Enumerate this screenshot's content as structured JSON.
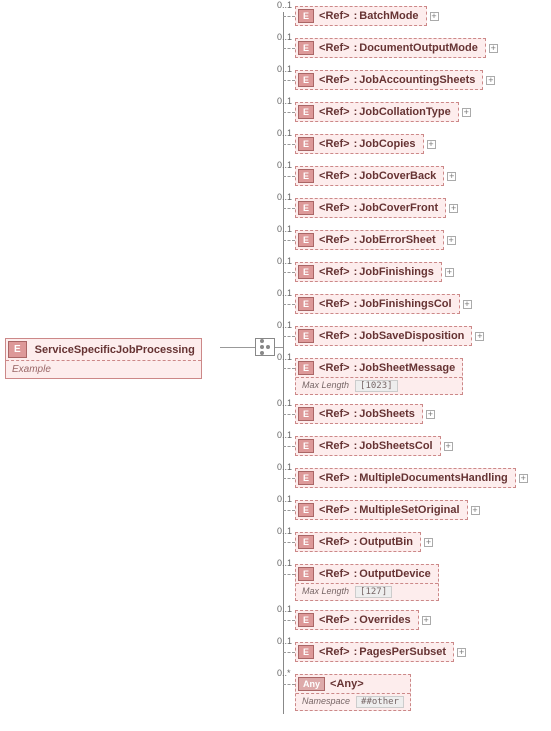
{
  "root": {
    "badge": "E",
    "name": "ServiceSpecificJobProcessing",
    "footer": "Example"
  },
  "refLabel": "<Ref>",
  "anyBadge": "Any",
  "anyLabel": "<Any>",
  "items": [
    {
      "occ": "0..1",
      "badge": "E",
      "sep": " : ",
      "label": "BatchMode",
      "expand": true
    },
    {
      "occ": "0..1",
      "badge": "E",
      "sep": " : ",
      "label": "DocumentOutputMode",
      "expand": true
    },
    {
      "occ": "0..1",
      "badge": "E",
      "sep": " : ",
      "label": "JobAccountingSheets",
      "expand": true
    },
    {
      "occ": "0..1",
      "badge": "E",
      "sep": " : ",
      "label": "JobCollationType",
      "expand": true
    },
    {
      "occ": "0..1",
      "badge": "E",
      "sep": " : ",
      "label": "JobCopies",
      "expand": true
    },
    {
      "occ": "0..1",
      "badge": "E",
      "sep": " : ",
      "label": "JobCoverBack",
      "expand": true
    },
    {
      "occ": "0..1",
      "badge": "E",
      "sep": " : ",
      "label": "JobCoverFront",
      "expand": true
    },
    {
      "occ": "0..1",
      "badge": "E",
      "sep": " : ",
      "label": "JobErrorSheet",
      "expand": true
    },
    {
      "occ": "0..1",
      "badge": "E",
      "sep": " : ",
      "label": "JobFinishings",
      "expand": true
    },
    {
      "occ": "0..1",
      "badge": "E",
      "sep": " : ",
      "label": "JobFinishingsCol",
      "expand": true
    },
    {
      "occ": "0..1",
      "badge": "E",
      "sep": " : ",
      "label": "JobSaveDisposition",
      "expand": true
    },
    {
      "occ": "0..1",
      "badge": "E",
      "sep": " : ",
      "label": "JobSheetMessage",
      "footerKey": "Max Length",
      "footerVal": "[1023]"
    },
    {
      "occ": "0..1",
      "badge": "E",
      "sep": " : ",
      "label": "JobSheets",
      "expand": true
    },
    {
      "occ": "0..1",
      "badge": "E",
      "sep": " : ",
      "label": "JobSheetsCol",
      "expand": true
    },
    {
      "occ": "0..1",
      "badge": "E",
      "sep": " : ",
      "label": "MultipleDocumentsHandling",
      "expand": true
    },
    {
      "occ": "0..1",
      "badge": "E",
      "sep": " : ",
      "label": "MultipleSetOriginal",
      "expand": true
    },
    {
      "occ": "0..1",
      "badge": "E",
      "sep": " : ",
      "label": "OutputBin",
      "expand": true
    },
    {
      "occ": "0..1",
      "badge": "E",
      "sep": " : ",
      "label": "OutputDevice",
      "footerKey": "Max Length",
      "footerVal": "[127]"
    },
    {
      "occ": "0..1",
      "badge": "E",
      "sep": " : ",
      "label": "Overrides",
      "expand": true
    },
    {
      "occ": "0..1",
      "badge": "E",
      "sep": " : ",
      "label": "PagesPerSubset",
      "expand": true
    },
    {
      "occ": "0..*",
      "any": true,
      "footerKey": "Namespace",
      "footerVal": "##other"
    }
  ]
}
